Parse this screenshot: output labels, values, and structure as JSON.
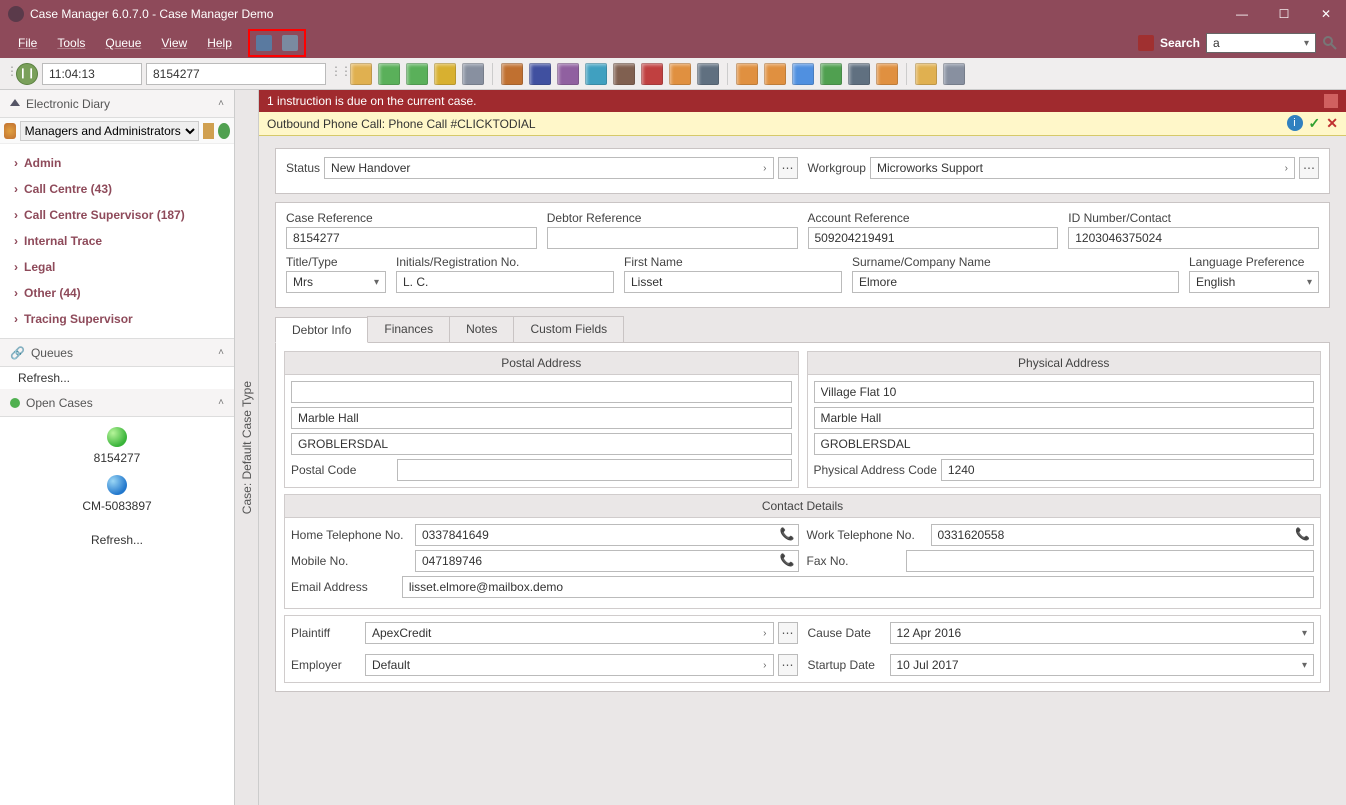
{
  "window": {
    "title": "Case Manager 6.0.7.0 - Case Manager Demo"
  },
  "menu": {
    "items": [
      "File",
      "Tools",
      "Queue",
      "View",
      "Help"
    ],
    "search_label": "Search",
    "search_value": "a"
  },
  "quickbar": {
    "time": "11:04:13",
    "case_ref": "8154277"
  },
  "sidebar": {
    "diary_title": "Electronic Diary",
    "managers_label": "Managers and Administrators",
    "tree": [
      {
        "label": "Admin"
      },
      {
        "label": "Call Centre (43)"
      },
      {
        "label": "Call Centre Supervisor (187)"
      },
      {
        "label": "Internal Trace"
      },
      {
        "label": "Legal"
      },
      {
        "label": "Other (44)"
      },
      {
        "label": "Tracing Supervisor"
      }
    ],
    "queues_title": "Queues",
    "queues_refresh": "Refresh...",
    "open_cases_title": "Open Cases",
    "open_cases": [
      {
        "ref": "8154277",
        "color": "green"
      },
      {
        "ref": "CM-5083897",
        "color": "blue"
      }
    ],
    "open_cases_refresh": "Refresh..."
  },
  "vtab_label": "Case: Default Case Type",
  "alert_text": "1 instruction is due on the current case.",
  "notif_text": "Outbound Phone Call: Phone Call #CLICKTODIAL",
  "form": {
    "status_label": "Status",
    "status_value": "New Handover",
    "workgroup_label": "Workgroup",
    "workgroup_value": "Microworks Support",
    "case_ref_label": "Case Reference",
    "case_ref_value": "8154277",
    "debtor_ref_label": "Debtor Reference",
    "debtor_ref_value": "",
    "account_ref_label": "Account Reference",
    "account_ref_value": "509204219491",
    "id_number_label": "ID Number/Contact",
    "id_number_value": "1203046375024",
    "title_type_label": "Title/Type",
    "title_type_value": "Mrs",
    "initials_label": "Initials/Registration No.",
    "initials_value": "L. C.",
    "first_name_label": "First Name",
    "first_name_value": "Lisset",
    "surname_label": "Surname/Company Name",
    "surname_value": "Elmore",
    "language_label": "Language Preference",
    "language_value": "English"
  },
  "tabs": {
    "debtor_info": "Debtor Info",
    "finances": "Finances",
    "notes": "Notes",
    "custom_fields": "Custom Fields"
  },
  "debtor": {
    "postal_title": "Postal Address",
    "postal_line1": "",
    "postal_line2": "Marble Hall",
    "postal_line3": "GROBLERSDAL",
    "postal_code_label": "Postal Code",
    "postal_code_value": "",
    "physical_title": "Physical Address",
    "physical_line1": "Village Flat 10",
    "physical_line2": "Marble Hall",
    "physical_line3": "GROBLERSDAL",
    "physical_code_label": "Physical Address Code",
    "physical_code_value": "1240",
    "contact_title": "Contact Details",
    "home_tel_label": "Home Telephone No.",
    "home_tel_value": "0337841649",
    "work_tel_label": "Work Telephone No.",
    "work_tel_value": "0331620558",
    "mobile_label": "Mobile No.",
    "mobile_value": "047189746",
    "fax_label": "Fax No.",
    "fax_value": "",
    "email_label": "Email Address",
    "email_value": "lisset.elmore@mailbox.demo",
    "plaintiff_label": "Plaintiff",
    "plaintiff_value": "ApexCredit",
    "cause_date_label": "Cause Date",
    "cause_date_value": "12 Apr 2016",
    "employer_label": "Employer",
    "employer_value": "Default",
    "startup_date_label": "Startup Date",
    "startup_date_value": "10 Jul 2017"
  },
  "icons": {
    "colors": [
      "#e0b050",
      "#5ab05a",
      "#5ab05a",
      "#d8b030",
      "#8890a0",
      "#c07030",
      "#4050a0",
      "#9060a0",
      "#40a0c0",
      "#806050",
      "#c04040",
      "#e09040",
      "#607080",
      "#e09040",
      "#e09040",
      "#5090e0",
      "#50a050",
      "#607080",
      "#e09040",
      "#e0b050",
      "#8890a0"
    ]
  }
}
